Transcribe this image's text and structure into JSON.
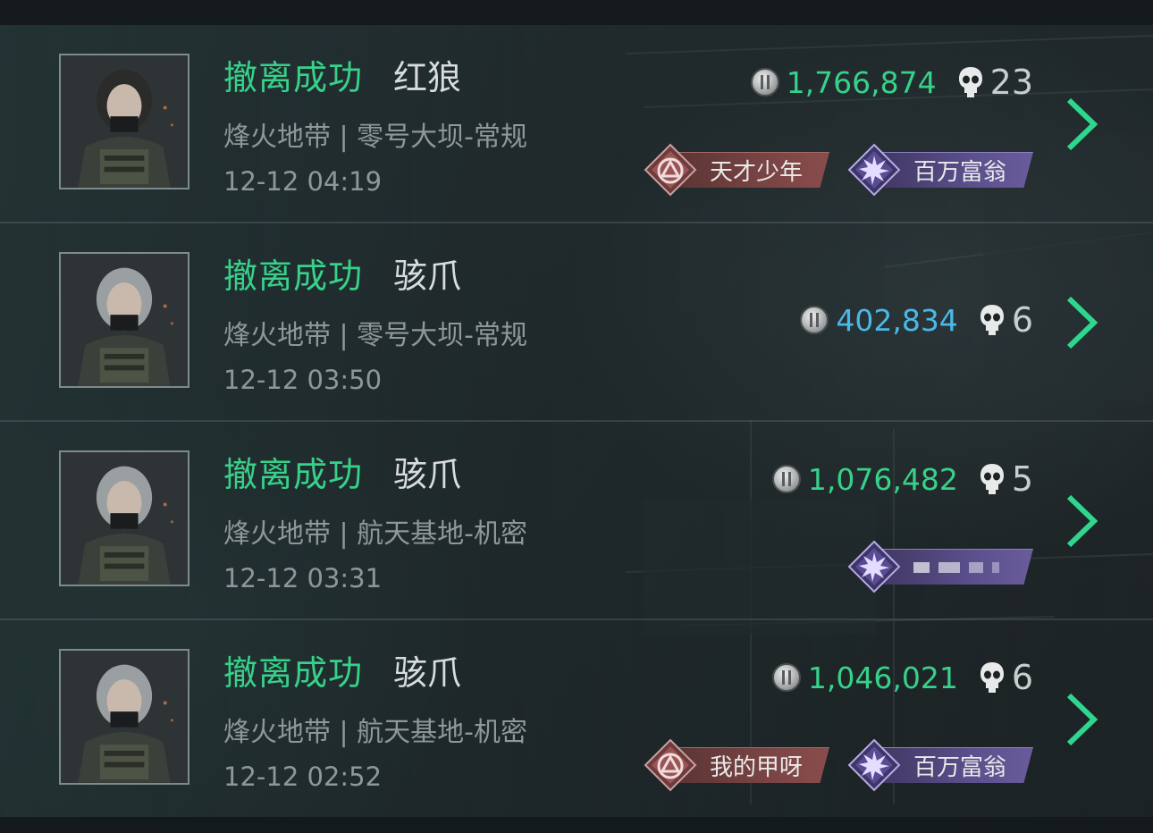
{
  "records": [
    {
      "status": "撤离成功",
      "operator": "红狼",
      "mode": "烽火地带 | 零号大坝-常规",
      "time": "12-12 04:19",
      "value": "1,766,874",
      "value_color": "#37d18a",
      "kills": "23",
      "badges": [
        {
          "type": "red",
          "label": "天才少年"
        },
        {
          "type": "purple",
          "label": "百万富翁"
        }
      ]
    },
    {
      "status": "撤离成功",
      "operator": "骇爪",
      "mode": "烽火地带 | 零号大坝-常规",
      "time": "12-12 03:50",
      "value": "402,834",
      "value_color": "#4ab8e8",
      "kills": "6",
      "badges": []
    },
    {
      "status": "撤离成功",
      "operator": "骇爪",
      "mode": "烽火地带 | 航天基地-机密",
      "time": "12-12 03:31",
      "value": "1,076,482",
      "value_color": "#37d18a",
      "kills": "5",
      "badges": [
        {
          "type": "purple",
          "label": ""
        }
      ]
    },
    {
      "status": "撤离成功",
      "operator": "骇爪",
      "mode": "烽火地带 | 航天基地-机密",
      "time": "12-12 02:52",
      "value": "1,046,021",
      "value_color": "#37d18a",
      "kills": "6",
      "badges": [
        {
          "type": "red",
          "label": "我的甲呀"
        },
        {
          "type": "purple",
          "label": "百万富翁"
        }
      ]
    }
  ],
  "icons": {
    "coin": "silver-coin-icon",
    "kills": "skull-icon",
    "detail": "chevron-right-icon",
    "red_badge": "triangle-emblem-icon",
    "purple_badge": "burst-emblem-icon"
  }
}
